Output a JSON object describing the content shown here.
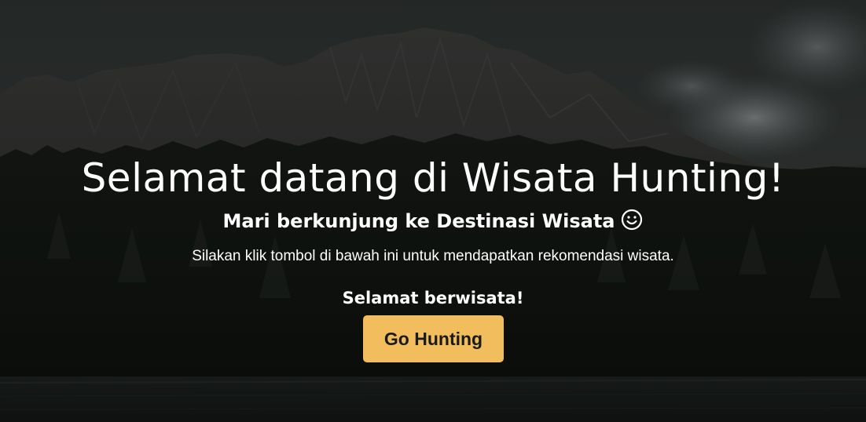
{
  "hero": {
    "title": "Selamat datang di Wisata Hunting!",
    "subtitle": "Mari berkunjung ke Destinasi Wisata",
    "subtitle_icon": "smile-icon",
    "description": "Silakan klik tombol di bawah ini untuk mendapatkan rekomendasi wisata.",
    "greeting": "Selamat berwisata!",
    "button_label": "Go Hunting"
  },
  "colors": {
    "button_bg": "#f2bd5c",
    "button_text": "#1a1a1a",
    "text": "#ffffff"
  }
}
